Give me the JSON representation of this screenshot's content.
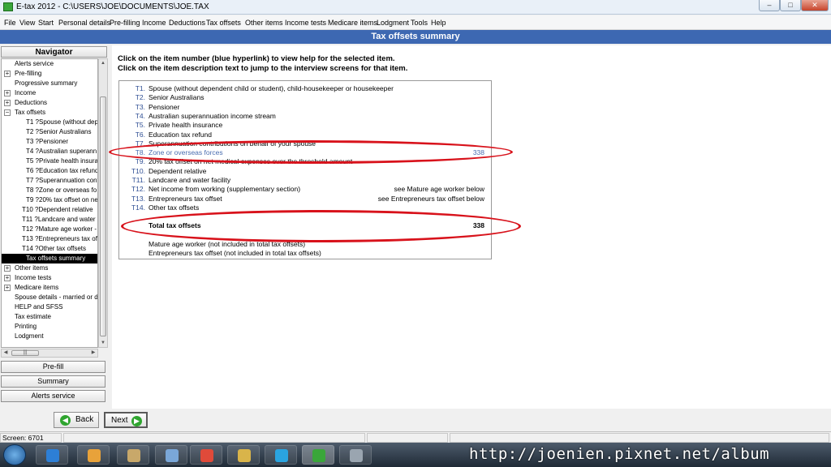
{
  "window": {
    "title": "E-tax 2012 - C:\\USERS\\JOE\\DOCUMENTS\\JOE.TAX",
    "controls": {
      "minimize": "–",
      "maximize": "□",
      "close": "✕"
    }
  },
  "menu": [
    "File",
    "View",
    "Start",
    "Personal details",
    "Pre-filling",
    "Income",
    "Deductions",
    "Tax offsets",
    "Other items",
    "Income tests",
    "Medicare items",
    "Lodgment",
    "Tools",
    "Help"
  ],
  "page_title": "Tax offsets summary",
  "navigator": {
    "title": "Navigator",
    "items": [
      {
        "label": "Alerts service",
        "expander": ""
      },
      {
        "label": "Pre-filling",
        "expander": "+"
      },
      {
        "label": "Progressive summary",
        "expander": ""
      },
      {
        "label": "Income",
        "expander": "+"
      },
      {
        "label": "Deductions",
        "expander": "+"
      },
      {
        "label": "Tax offsets",
        "expander": "−"
      },
      {
        "label": "T1 ?Spouse (without dep",
        "expander": ""
      },
      {
        "label": "T2 ?Senior Australians",
        "expander": ""
      },
      {
        "label": "T3 ?Pensioner",
        "expander": ""
      },
      {
        "label": "T4 ?Australian superann",
        "expander": ""
      },
      {
        "label": "T5 ?Private health insura",
        "expander": ""
      },
      {
        "label": "T6 ?Education tax refund",
        "expander": ""
      },
      {
        "label": "T7 ?Superannuation cont",
        "expander": ""
      },
      {
        "label": "T8 ?Zone or overseas fo",
        "expander": ""
      },
      {
        "label": "T9 ?20% tax offset on ne",
        "expander": ""
      },
      {
        "label": "T10 ?Dependent relative",
        "expander": ""
      },
      {
        "label": "T11 ?Landcare and water",
        "expander": ""
      },
      {
        "label": "T12 ?Mature age worker -",
        "expander": ""
      },
      {
        "label": "T13 ?Entrepreneurs tax of",
        "expander": ""
      },
      {
        "label": "T14 ?Other tax offsets",
        "expander": ""
      },
      {
        "label": "Tax offsets summary",
        "expander": "",
        "selected": true
      },
      {
        "label": "Other items",
        "expander": "+"
      },
      {
        "label": "Income tests",
        "expander": "+"
      },
      {
        "label": "Medicare items",
        "expander": "+"
      },
      {
        "label": "Spouse details - married or d",
        "expander": ""
      },
      {
        "label": "HELP and SFSS",
        "expander": ""
      },
      {
        "label": "Tax estimate",
        "expander": ""
      },
      {
        "label": "Printing",
        "expander": ""
      },
      {
        "label": "Lodgment",
        "expander": ""
      }
    ],
    "buttons": [
      "Pre-fill",
      "Summary",
      "Alerts service"
    ],
    "scroll_glyphs": {
      "up": "▲",
      "down": "▼",
      "left": "◀",
      "right": "▶",
      "grip": "|||"
    }
  },
  "instructions": [
    "Click on the item number (blue hyperlink) to view help for the selected item.",
    "Click on the item description text to jump to the interview screens for that item."
  ],
  "offsets": [
    {
      "code": "T1.",
      "desc": "Spouse (without dependent child or student), child-housekeeper or housekeeper",
      "note": "",
      "amount": ""
    },
    {
      "code": "T2.",
      "desc": "Senior Australians",
      "note": "",
      "amount": ""
    },
    {
      "code": "T3.",
      "desc": "Pensioner",
      "note": "",
      "amount": ""
    },
    {
      "code": "T4.",
      "desc": "Australian superannuation income stream",
      "note": "",
      "amount": ""
    },
    {
      "code": "T5.",
      "desc": "Private health insurance",
      "note": "",
      "amount": ""
    },
    {
      "code": "T6.",
      "desc": "Education tax refund",
      "note": "",
      "amount": ""
    },
    {
      "code": "T7.",
      "desc": "Superannuation contributions on behalf of your spouse",
      "note": "",
      "amount": ""
    },
    {
      "code": "T8.",
      "desc": "Zone or overseas forces",
      "note": "",
      "amount": "338",
      "highlight": true
    },
    {
      "code": "T9.",
      "desc": "20% tax offset on net medical expenses over the threshold amount",
      "note": "",
      "amount": ""
    },
    {
      "code": "T10.",
      "desc": "Dependent relative",
      "note": "",
      "amount": ""
    },
    {
      "code": "T11.",
      "desc": "Landcare and water facility",
      "note": "",
      "amount": ""
    },
    {
      "code": "T12.",
      "desc": "Net income from working (supplementary section)",
      "note": "see Mature age worker below",
      "amount": ""
    },
    {
      "code": "T13.",
      "desc": "Entrepreneurs tax offset",
      "note": "see Entrepreneurs tax offset below",
      "amount": ""
    },
    {
      "code": "T14.",
      "desc": "Other tax offsets",
      "note": "",
      "amount": ""
    }
  ],
  "total": {
    "label": "Total tax offsets",
    "amount": "338"
  },
  "footnotes": [
    "Mature age worker (not included in total tax offsets)",
    "Entrepreneurs tax offset (not included in total tax offsets)"
  ],
  "nav_buttons": {
    "back": "Back",
    "next": "Next",
    "back_icon": "◀",
    "next_icon": "▶"
  },
  "status": {
    "screen": "Screen: 6701"
  },
  "taskbar": {
    "items": [
      "internet-explorer",
      "media-player",
      "explorer",
      "utility",
      "chrome",
      "folder",
      "skype",
      "e-tax",
      "other"
    ],
    "colors": [
      "#2d7fd6",
      "#e8a23a",
      "#c8a86a",
      "#7aa7d8",
      "#e04a3a",
      "#d9b44a",
      "#2aa4e0",
      "#3aa63a",
      "#9aa5b0"
    ]
  },
  "watermark": "http://joenien.pixnet.net/album"
}
